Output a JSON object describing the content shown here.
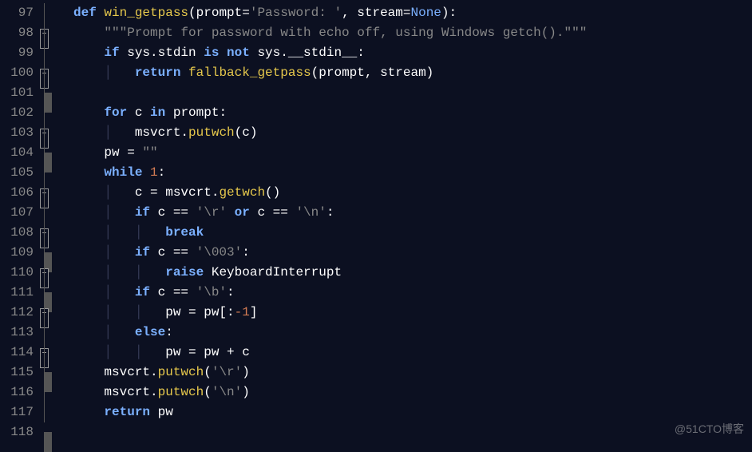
{
  "watermark": "@51CTO博客",
  "lines": [
    {
      "num": "97",
      "fold": "box",
      "segs": [
        [
          "kw",
          "def "
        ],
        [
          "fn",
          "win_getpass"
        ],
        [
          "op",
          "(prompt="
        ],
        [
          "str",
          "'Password: '"
        ],
        [
          "op",
          ", stream="
        ],
        [
          "kwv",
          "None"
        ],
        [
          "op",
          "):"
        ]
      ]
    },
    {
      "num": "98",
      "fold": "line",
      "segs": [
        [
          "op",
          "    "
        ],
        [
          "str",
          "\"\"\"Prompt for password with echo off, using Windows getch().\"\"\""
        ]
      ]
    },
    {
      "num": "99",
      "fold": "box",
      "segs": [
        [
          "op",
          "    "
        ],
        [
          "kw",
          "if"
        ],
        [
          "op",
          " sys.stdin "
        ],
        [
          "kw",
          "is not"
        ],
        [
          "op",
          " sys.__stdin__:"
        ]
      ]
    },
    {
      "num": "100",
      "fold": "end",
      "segs": [
        [
          "op",
          "    "
        ],
        [
          "indent-guide",
          "│   "
        ],
        [
          "kw",
          "return"
        ],
        [
          "op",
          " "
        ],
        [
          "fn",
          "fallback_getpass"
        ],
        [
          "op",
          "(prompt, stream)"
        ]
      ]
    },
    {
      "num": "101",
      "fold": "line",
      "segs": [
        [
          "op",
          "    "
        ]
      ]
    },
    {
      "num": "102",
      "fold": "box",
      "segs": [
        [
          "op",
          "    "
        ],
        [
          "kw",
          "for"
        ],
        [
          "op",
          " c "
        ],
        [
          "kw",
          "in"
        ],
        [
          "op",
          " prompt:"
        ]
      ]
    },
    {
      "num": "103",
      "fold": "end",
      "segs": [
        [
          "op",
          "    "
        ],
        [
          "indent-guide",
          "│   "
        ],
        [
          "op",
          "msvcrt."
        ],
        [
          "fn",
          "putwch"
        ],
        [
          "op",
          "(c)"
        ]
      ]
    },
    {
      "num": "104",
      "fold": "line",
      "segs": [
        [
          "op",
          "    pw = "
        ],
        [
          "str",
          "\"\""
        ]
      ]
    },
    {
      "num": "105",
      "fold": "box",
      "segs": [
        [
          "op",
          "    "
        ],
        [
          "kw",
          "while"
        ],
        [
          "op",
          " "
        ],
        [
          "num",
          "1"
        ],
        [
          "op",
          ":"
        ]
      ]
    },
    {
      "num": "106",
      "fold": "line",
      "segs": [
        [
          "op",
          "    "
        ],
        [
          "indent-guide",
          "│   "
        ],
        [
          "op",
          "c = msvcrt."
        ],
        [
          "fn",
          "getwch"
        ],
        [
          "op",
          "()"
        ]
      ]
    },
    {
      "num": "107",
      "fold": "box",
      "segs": [
        [
          "op",
          "    "
        ],
        [
          "indent-guide",
          "│   "
        ],
        [
          "kw",
          "if"
        ],
        [
          "op",
          " c == "
        ],
        [
          "str",
          "'\\r'"
        ],
        [
          "op",
          " "
        ],
        [
          "kw",
          "or"
        ],
        [
          "op",
          " c == "
        ],
        [
          "str",
          "'\\n'"
        ],
        [
          "op",
          ":"
        ]
      ]
    },
    {
      "num": "108",
      "fold": "end",
      "segs": [
        [
          "op",
          "    "
        ],
        [
          "indent-guide",
          "│   │   "
        ],
        [
          "kw",
          "break"
        ]
      ]
    },
    {
      "num": "109",
      "fold": "box",
      "segs": [
        [
          "op",
          "    "
        ],
        [
          "indent-guide",
          "│   "
        ],
        [
          "kw",
          "if"
        ],
        [
          "op",
          " c == "
        ],
        [
          "str",
          "'\\003'"
        ],
        [
          "op",
          ":"
        ]
      ]
    },
    {
      "num": "110",
      "fold": "end",
      "segs": [
        [
          "op",
          "    "
        ],
        [
          "indent-guide",
          "│   │   "
        ],
        [
          "kw",
          "raise"
        ],
        [
          "op",
          " KeyboardInterrupt"
        ]
      ]
    },
    {
      "num": "111",
      "fold": "box",
      "segs": [
        [
          "op",
          "    "
        ],
        [
          "indent-guide",
          "│   "
        ],
        [
          "kw",
          "if"
        ],
        [
          "op",
          " c == "
        ],
        [
          "str",
          "'\\b'"
        ],
        [
          "op",
          ":"
        ]
      ]
    },
    {
      "num": "112",
      "fold": "line",
      "segs": [
        [
          "op",
          "    "
        ],
        [
          "indent-guide",
          "│   │   "
        ],
        [
          "op",
          "pw = pw[:"
        ],
        [
          "num",
          "-1"
        ],
        [
          "op",
          "]"
        ]
      ]
    },
    {
      "num": "113",
      "fold": "box",
      "segs": [
        [
          "op",
          "    "
        ],
        [
          "indent-guide",
          "│   "
        ],
        [
          "kw",
          "else"
        ],
        [
          "op",
          ":"
        ]
      ]
    },
    {
      "num": "114",
      "fold": "end",
      "segs": [
        [
          "op",
          "    "
        ],
        [
          "indent-guide",
          "│   │   "
        ],
        [
          "op",
          "pw = pw + c"
        ]
      ]
    },
    {
      "num": "115",
      "fold": "line",
      "segs": [
        [
          "op",
          "    msvcrt."
        ],
        [
          "fn",
          "putwch"
        ],
        [
          "op",
          "("
        ],
        [
          "str",
          "'\\r'"
        ],
        [
          "op",
          ")"
        ]
      ]
    },
    {
      "num": "116",
      "fold": "line",
      "segs": [
        [
          "op",
          "    msvcrt."
        ],
        [
          "fn",
          "putwch"
        ],
        [
          "op",
          "("
        ],
        [
          "str",
          "'\\n'"
        ],
        [
          "op",
          ")"
        ]
      ]
    },
    {
      "num": "117",
      "fold": "end",
      "segs": [
        [
          "op",
          "    "
        ],
        [
          "kw",
          "return"
        ],
        [
          "op",
          " pw"
        ]
      ]
    },
    {
      "num": "118",
      "fold": "none",
      "segs": [
        [
          "op",
          ""
        ]
      ]
    }
  ]
}
